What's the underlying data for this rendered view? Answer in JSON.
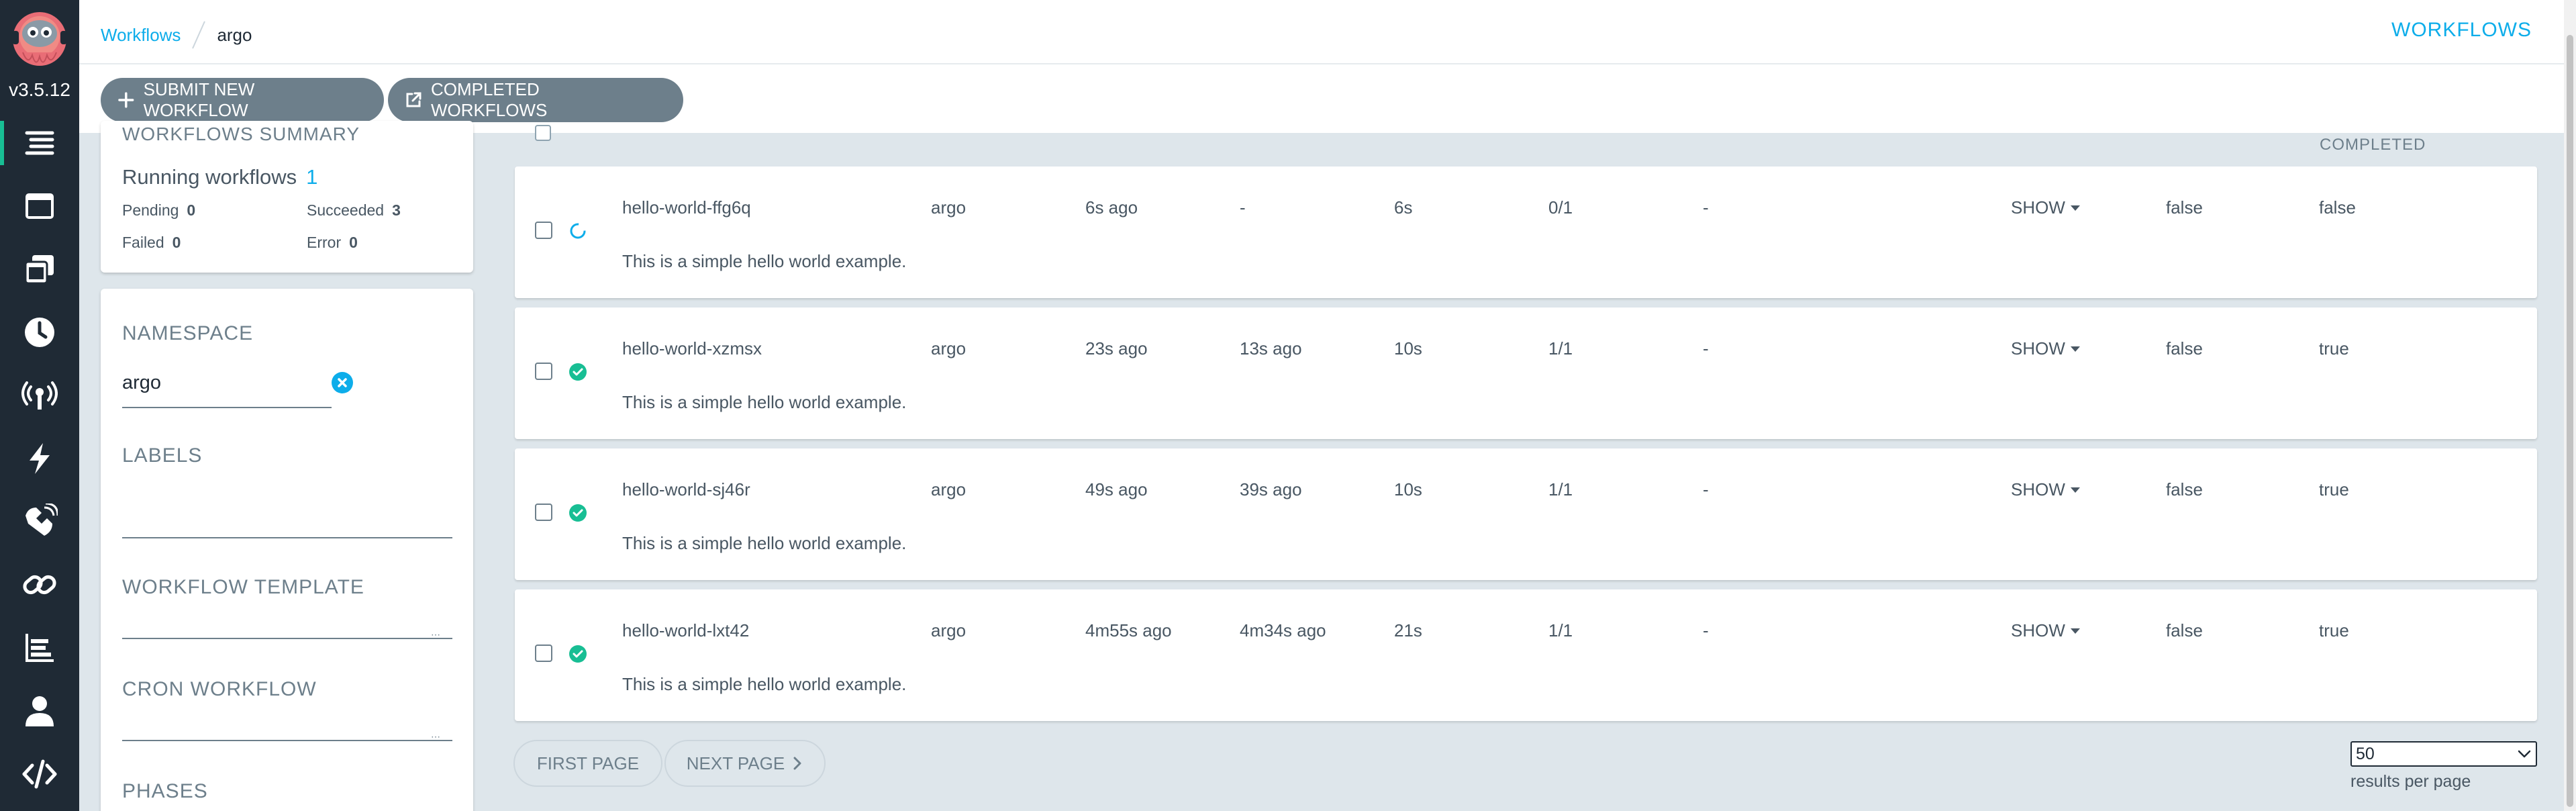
{
  "app": {
    "version": "v3.5.12",
    "accent": "#0dadea",
    "nav_bg": "#1f2a35",
    "success": "#18be94"
  },
  "breadcrumb": {
    "parent": "Workflows",
    "current": "argo"
  },
  "header": {
    "title": "WORKFLOWS"
  },
  "toolbar": {
    "submit_icon": "plus-icon",
    "submit_label": "SUBMIT NEW WORKFLOW",
    "completed_icon": "external-link-icon",
    "completed_label": "COMPLETED WORKFLOWS"
  },
  "nav": {
    "items": [
      {
        "icon": "workflows-icon",
        "active": true
      },
      {
        "icon": "workflow-templates-icon"
      },
      {
        "icon": "cluster-workflow-templates-icon"
      },
      {
        "icon": "cron-workflows-icon"
      },
      {
        "icon": "event-sources-icon"
      },
      {
        "icon": "sensors-icon"
      },
      {
        "icon": "event-flow-icon"
      },
      {
        "icon": "links-icon"
      },
      {
        "icon": "reports-icon"
      },
      {
        "icon": "user-icon"
      },
      {
        "icon": "api-docs-icon"
      }
    ]
  },
  "summary": {
    "title": "WORKFLOWS SUMMARY",
    "running_label": "Running workflows",
    "running_count": "1",
    "pending_label": "Pending",
    "pending_count": "0",
    "succeeded_label": "Succeeded",
    "succeeded_count": "3",
    "failed_label": "Failed",
    "failed_count": "0",
    "error_label": "Error",
    "error_count": "0"
  },
  "filters": {
    "namespace_label": "NAMESPACE",
    "namespace_value": "argo",
    "labels_label": "LABELS",
    "workflow_template_label": "WORKFLOW TEMPLATE",
    "cron_workflow_label": "CRON WORKFLOW",
    "phases_label": "PHASES"
  },
  "list": {
    "header_completed": "COMPLETED",
    "rows": [
      {
        "name": "hello-world-ffg6q",
        "namespace": "argo",
        "started": "6s ago",
        "finished": "-",
        "duration": "6s",
        "progress": "0/1",
        "message": "-",
        "details": "SHOW",
        "archived": "false",
        "completed": "false",
        "description": "This is a simple hello world example.",
        "status": "running"
      },
      {
        "name": "hello-world-xzmsx",
        "namespace": "argo",
        "started": "23s ago",
        "finished": "13s ago",
        "duration": "10s",
        "progress": "1/1",
        "message": "-",
        "details": "SHOW",
        "archived": "false",
        "completed": "true",
        "description": "This is a simple hello world example.",
        "status": "succeeded"
      },
      {
        "name": "hello-world-sj46r",
        "namespace": "argo",
        "started": "49s ago",
        "finished": "39s ago",
        "duration": "10s",
        "progress": "1/1",
        "message": "-",
        "details": "SHOW",
        "archived": "false",
        "completed": "true",
        "description": "This is a simple hello world example.",
        "status": "succeeded"
      },
      {
        "name": "hello-world-lxt42",
        "namespace": "argo",
        "started": "4m55s ago",
        "finished": "4m34s ago",
        "duration": "21s",
        "progress": "1/1",
        "message": "-",
        "details": "SHOW",
        "archived": "false",
        "completed": "true",
        "description": "This is a simple hello world example.",
        "status": "succeeded"
      }
    ]
  },
  "pagination": {
    "first_label": "FIRST PAGE",
    "next_label": "NEXT PAGE",
    "per_page_value": "50",
    "per_page_label": "results per page"
  }
}
